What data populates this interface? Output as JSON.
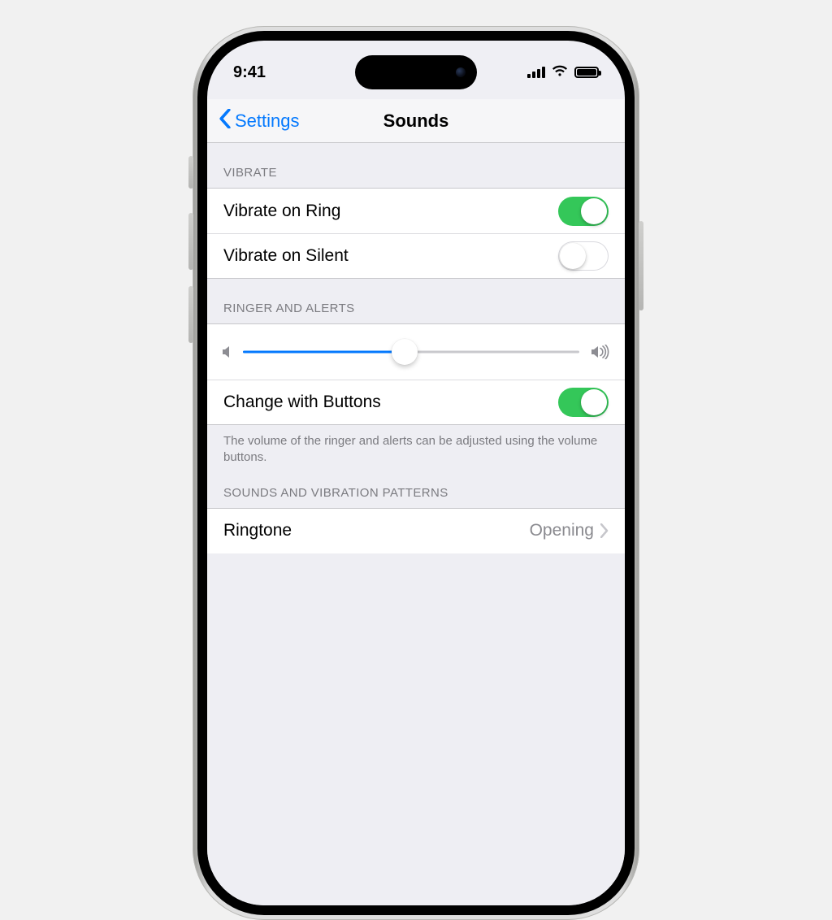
{
  "status": {
    "time": "9:41"
  },
  "nav": {
    "back_label": "Settings",
    "title": "Sounds"
  },
  "colors": {
    "accent": "#0479fe",
    "toggle_on": "#34c759"
  },
  "sections": {
    "vibrate": {
      "header": "VIBRATE",
      "items": [
        {
          "label": "Vibrate on Ring",
          "on": true
        },
        {
          "label": "Vibrate on Silent",
          "on": false
        }
      ]
    },
    "ringer": {
      "header": "RINGER AND ALERTS",
      "volume_percent": 48,
      "change_with_buttons": {
        "label": "Change with Buttons",
        "on": true
      },
      "footer": "The volume of the ringer and alerts can be adjusted using the volume buttons."
    },
    "patterns": {
      "header": "SOUNDS AND VIBRATION PATTERNS",
      "ringtone": {
        "label": "Ringtone",
        "value": "Opening"
      }
    }
  }
}
